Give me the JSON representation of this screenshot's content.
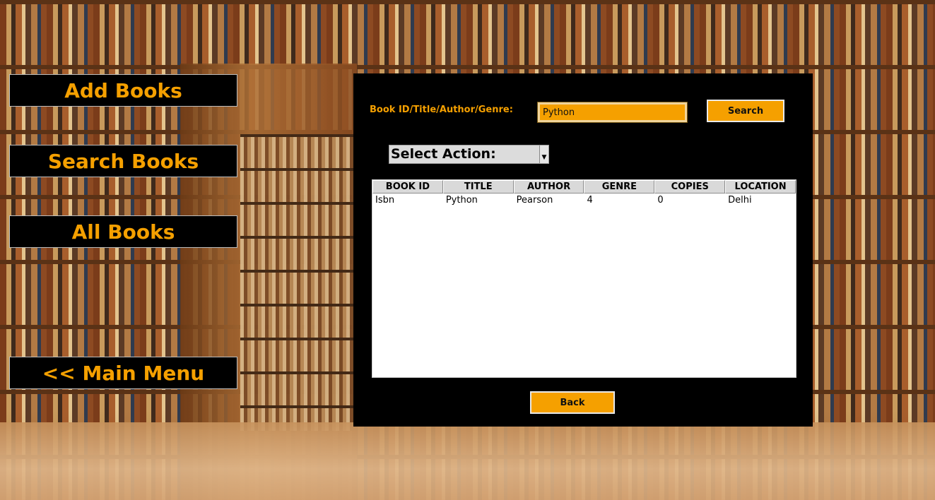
{
  "sidebar": {
    "add_books": "Add Books",
    "search_books": "Search Books",
    "all_books": "All Books",
    "main_menu": "<< Main Menu"
  },
  "search": {
    "label": "Book ID/Title/Author/Genre:",
    "value": "Python",
    "button": "Search"
  },
  "action": {
    "select_label": "Select Action:"
  },
  "table": {
    "columns": [
      "BOOK ID",
      "TITLE",
      "AUTHOR",
      "GENRE",
      "COPIES",
      "LOCATION"
    ],
    "rows": [
      [
        "Isbn",
        "Python",
        "Pearson",
        "4",
        "0",
        "Delhi"
      ]
    ]
  },
  "footer": {
    "back": "Back"
  },
  "colors": {
    "accent": "#f5a000",
    "panel": "#000000"
  }
}
